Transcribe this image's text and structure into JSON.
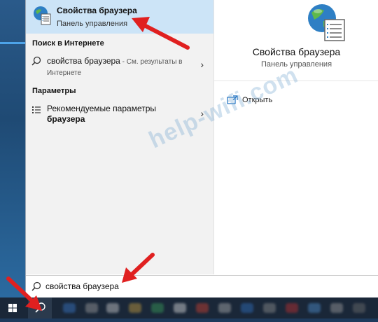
{
  "best_match": {
    "title": "Свойства браузера",
    "subtitle": "Панель управления",
    "icon": "internet-options-icon"
  },
  "web_section": {
    "header": "Поиск в Интернете",
    "result": {
      "query": "свойства браузера",
      "hint_line1": " - См. результаты в",
      "hint_line2": "Интернете",
      "icon": "search-icon"
    }
  },
  "settings_section": {
    "header": "Параметры",
    "result": {
      "line1": "Рекомендуемые параметры",
      "line2": "браузера",
      "icon": "settings-list-icon"
    }
  },
  "preview": {
    "title": "Свойства браузера",
    "subtitle": "Панель управления",
    "open_label": "Открыть",
    "icon": "internet-options-icon"
  },
  "watermark": "help-wifi.com",
  "search": {
    "value": "свойства браузера",
    "icon": "search-icon"
  },
  "taskbar": {
    "start_icon": "windows-logo-icon",
    "search_icon": "search-icon"
  },
  "colors": {
    "selection": "#cce4f7",
    "left_pane": "#f2f2f2",
    "taskbar": "#1a2738",
    "arrow": "#e02020"
  }
}
